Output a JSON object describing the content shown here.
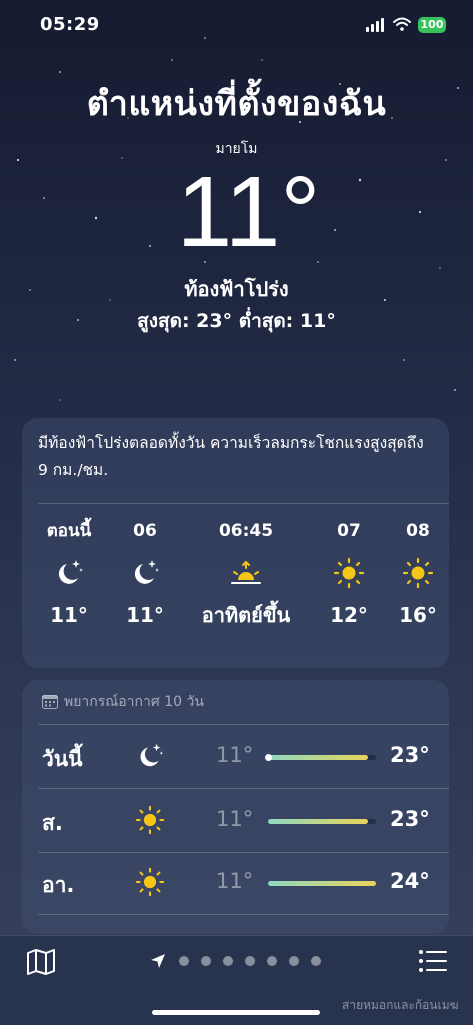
{
  "status_bar": {
    "time": "05:29",
    "battery": "100"
  },
  "hero": {
    "title": "ตำแหน่งที่ตั้งของฉัน",
    "subtitle": "มายโม",
    "temperature": "11°",
    "condition": "ท้องฟ้าโปร่ง",
    "high_low": "สูงสุด: 23°  ต่ำสุด: 11°"
  },
  "hourly": {
    "summary": "มีท้องฟ้าโปร่งตลอดทั้งวัน ความเร็วลมกระโชกแรงสูงสุดถึง 9 กม./ชม.",
    "items": [
      {
        "label": "ตอนนี้",
        "icon": "moon-stars-icon",
        "temp": "11°"
      },
      {
        "label": "06",
        "icon": "moon-stars-icon",
        "temp": "11°"
      },
      {
        "label": "06:45",
        "icon": "sunrise-icon",
        "temp": "อาทิตย์ขึ้น"
      },
      {
        "label": "07",
        "icon": "sun-icon",
        "temp": "12°"
      },
      {
        "label": "08",
        "icon": "sun-icon",
        "temp": "16°"
      }
    ]
  },
  "forecast": {
    "header": "พยากรณ์อากาศ 10 วัน",
    "temp_range": [
      11,
      24
    ],
    "rows": [
      {
        "day": "วันนี้",
        "icon": "moon-stars-icon",
        "low": "11°",
        "high": "23°",
        "low_value": 11,
        "high_value": 23,
        "current_value": 11
      },
      {
        "day": "ส.",
        "icon": "sun-icon",
        "low": "11°",
        "high": "23°",
        "low_value": 11,
        "high_value": 23
      },
      {
        "day": "อา.",
        "icon": "sun-icon",
        "low": "11°",
        "high": "24°",
        "low_value": 11,
        "high_value": 24
      }
    ]
  },
  "bottom_bar": {
    "page_count": 7,
    "watermark": "สายหมอกและก้อนเมฆ"
  },
  "colors": {
    "battery": "#38c25c",
    "sun": "#f5c518",
    "bar_start": "#8fd9c2",
    "bar_end": "#e9d45a"
  }
}
